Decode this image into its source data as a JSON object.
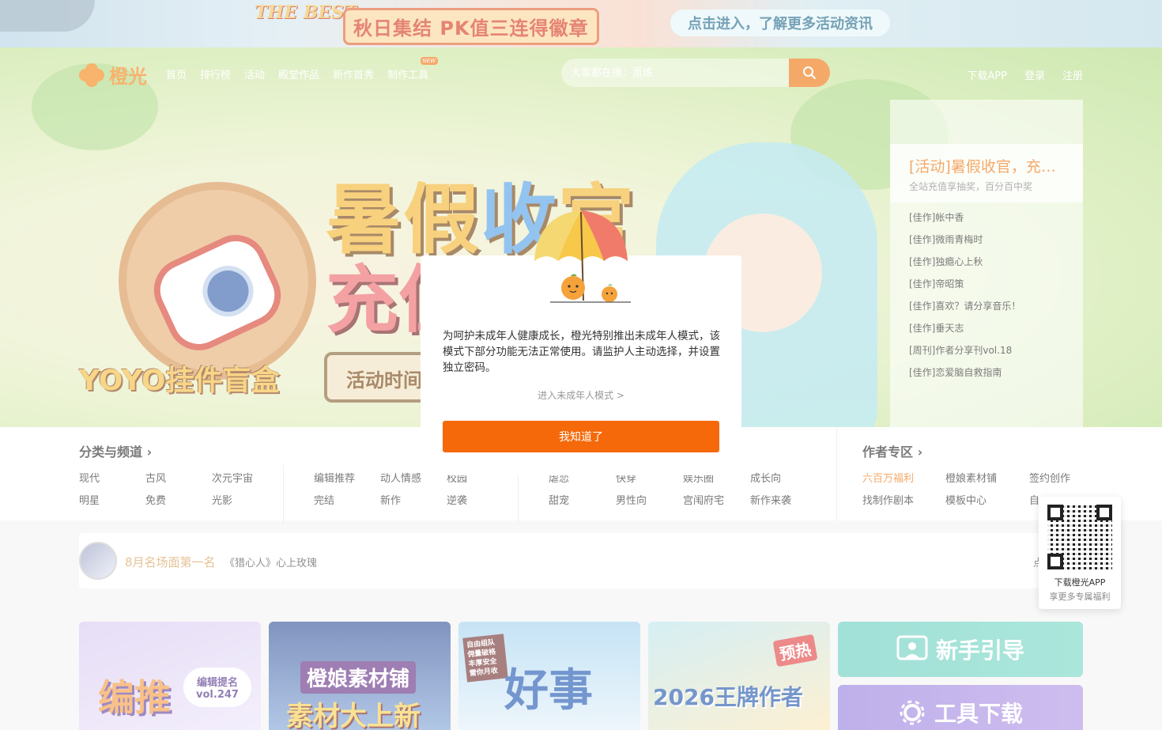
{
  "promo": {
    "best": "THE BEST",
    "slogan": "秋日集结 PK值三连得徽章",
    "cta": "点击进入，了解更多活动资讯"
  },
  "header": {
    "logo": "橙光",
    "menu": [
      "首页",
      "排行榜",
      "活动",
      "殿堂作品",
      "新作首秀",
      "制作工具"
    ],
    "new_badge": "NEW",
    "search_placeholder": "大家都在搜：觅炼",
    "right": [
      "下载APP",
      "登录",
      "注册"
    ]
  },
  "hero": {
    "title_line1_a": "暑假",
    "title_line1_b": "收",
    "title_line1_c": "官",
    "title_line2": "充值",
    "yoyo": "YOYO挂件盲盒",
    "scroll": "活动时间"
  },
  "news": {
    "featured_title": "[活动]暑假收官，充值福利",
    "featured_sub": "全站充值享抽奖，百分百中奖",
    "items": [
      "[佳作]帐中香",
      "[佳作]微雨青梅时",
      "[佳作]独瘾心上秋",
      "[佳作]帝昭策",
      "[佳作]喜欢？请分享音乐！",
      "[佳作]垂天志",
      "[周刊]作者分享刊vol.18",
      "[佳作]恋爱脑自救指南"
    ]
  },
  "categories": {
    "heading": "分类与频道",
    "col1": [
      "现代",
      "古风",
      "次元宇宙",
      "明星",
      "免费",
      "光影"
    ],
    "col2": [
      "编辑推荐",
      "动人情感",
      "校园",
      "完结",
      "新作",
      "逆袭"
    ],
    "col3": [
      "虐恋",
      "快穿",
      "娱乐圈",
      "成长向",
      "甜宠",
      "男性向",
      "宫闱府宅",
      "新作来袭"
    ],
    "author_heading": "作者专区",
    "author": [
      "六百万福利",
      "橙娘素材铺",
      "签约创作",
      "找制作剧本",
      "模板中心",
      "自"
    ]
  },
  "announce": {
    "title": "8月名场面第一名",
    "text": "《猎心人》心上玫瑰",
    "more": "点"
  },
  "cards": {
    "c1_a": "编推",
    "c1_b": "编辑提名 vol.247",
    "c2": "橙娘素材铺",
    "c2_b": "素材大上新",
    "c3": "好事",
    "c3_note": "自由组队 佣量破格 丰厚安全 雷你月收",
    "c4_a": "预热",
    "c4_b": "2026王牌作者",
    "side1": "新手引导",
    "side2": "工具下载"
  },
  "qr": {
    "line1": "下载橙光APP",
    "line2": "享更多专属福利"
  },
  "modal": {
    "message": "为呵护未成年人健康成长，橙光特别推出未成年人模式，该模式下部分功能无法正常使用。请监护人主动选择，并设置独立密码。",
    "link": "进入未成年人模式 >",
    "button": "我知道了"
  },
  "colors": {
    "brand": "#f58a1f",
    "button": "#f5690a"
  }
}
